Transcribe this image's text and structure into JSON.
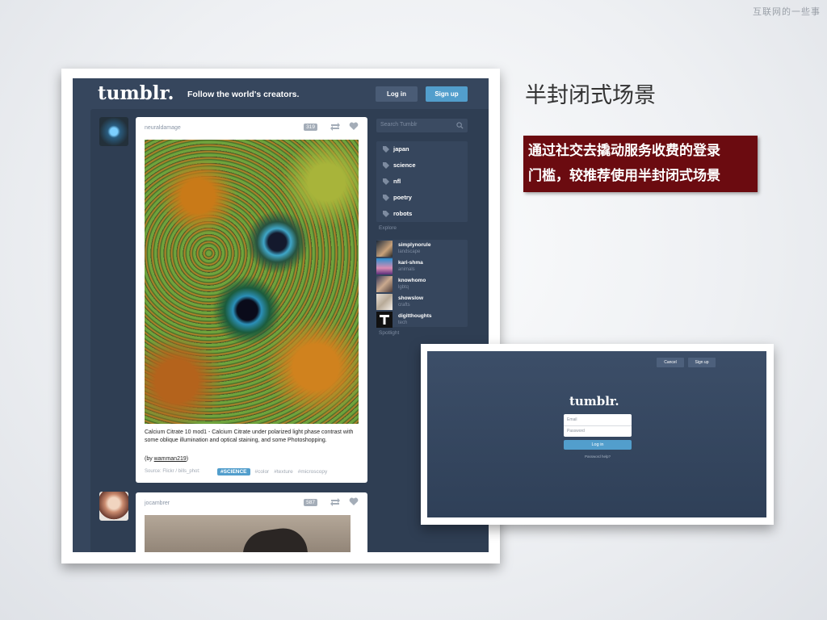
{
  "watermark": "互联网的一些事",
  "heading": "半封闭式场景",
  "callout": {
    "line1": "通过社交去撬动服务收费的登录",
    "line2": "门槛，较推荐使用半封闭式场景"
  },
  "main_screen": {
    "logo": "tumblr.",
    "tagline": "Follow the world's creators.",
    "login_label": "Log in",
    "signup_label": "Sign up",
    "search_placeholder": "Search Tumblr",
    "tags": [
      "japan",
      "science",
      "nfl",
      "poetry",
      "robots"
    ],
    "explore_label": "Explore",
    "spotlight": [
      {
        "name": "simplynorule",
        "category": "landscape"
      },
      {
        "name": "kari-shma",
        "category": "animals"
      },
      {
        "name": "knowhomo",
        "category": "lgbtq"
      },
      {
        "name": "showslow",
        "category": "crafts"
      },
      {
        "name": "digitthoughts",
        "category": "tech"
      }
    ],
    "spotlight_label": "Spotlight",
    "posts": [
      {
        "author": "neuraldamage",
        "notes": "319",
        "caption": "Calcium Citrate 10 mod1 - Calcium Citrate under polarized light phase contrast with some oblique illumination and optical staining, and some Photoshopping.",
        "by_prefix": "(by ",
        "by_user": "wamman219",
        "by_suffix": ")",
        "source": "Source: Flickr / bills_phot:",
        "tags": [
          "#SCIENCE",
          "#color",
          "#texture",
          "#microscopy"
        ]
      },
      {
        "author": "jocambrer",
        "notes": "587"
      }
    ]
  },
  "login_screen": {
    "cancel_label": "Cancel",
    "signup_label": "Sign up",
    "logo": "tumblr.",
    "email_placeholder": "Email",
    "password_placeholder": "Password",
    "login_label": "Log in",
    "forgot_label": "Password help?"
  },
  "colors": {
    "tumblr_bg": "#36465d",
    "accent_blue": "#529ecc",
    "callout_bg": "#6b0b10"
  }
}
